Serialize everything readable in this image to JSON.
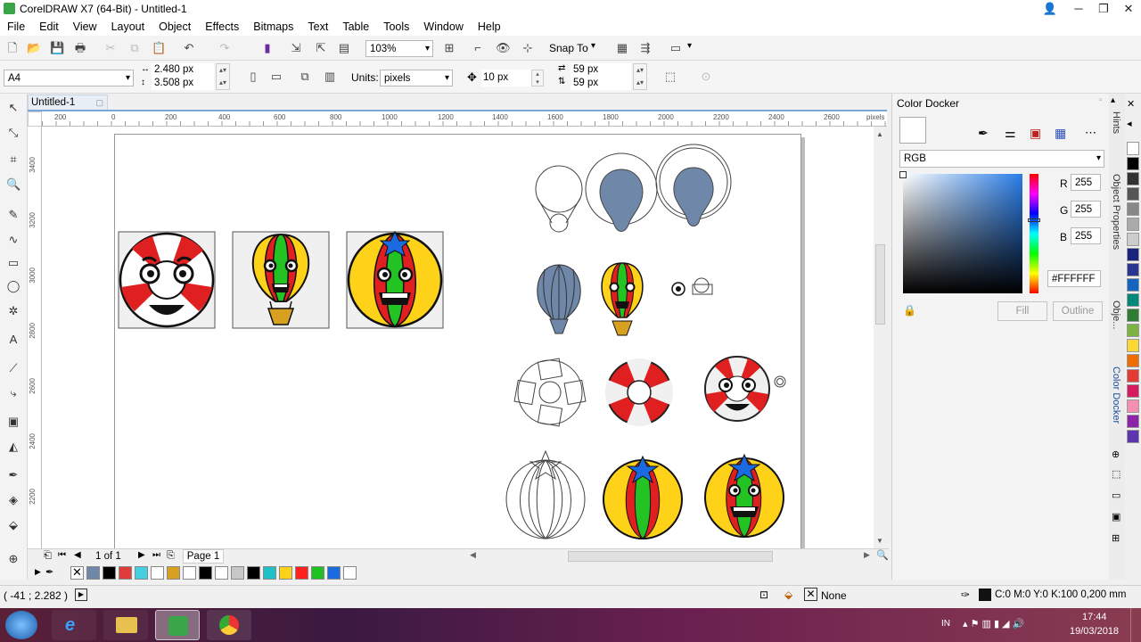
{
  "window": {
    "title": "CorelDRAW X7 (64-Bit) - Untitled-1"
  },
  "menu": [
    "File",
    "Edit",
    "View",
    "Layout",
    "Object",
    "Effects",
    "Bitmaps",
    "Text",
    "Table",
    "Tools",
    "Window",
    "Help"
  ],
  "toolbar": {
    "zoom": "103%",
    "snap_to": "Snap To"
  },
  "property_bar": {
    "page_size": "A4",
    "width": "2.480 px",
    "height": "3.508 px",
    "units_label": "Units:",
    "units": "pixels",
    "nudge": "10 px",
    "dup_x": "59 px",
    "dup_y": "59 px"
  },
  "document": {
    "tab": "Untitled-1"
  },
  "ruler": {
    "h_ticks": [
      "200",
      "0",
      "200",
      "400",
      "600",
      "800",
      "1000",
      "1200",
      "1400",
      "1600",
      "1800",
      "2000",
      "2200",
      "2400",
      "2600"
    ],
    "h_unit": "pixels",
    "v_ticks": [
      "3400",
      "3200",
      "3000",
      "2800",
      "2600",
      "2400",
      "2200"
    ]
  },
  "page_nav": {
    "count": "1 of 1",
    "page_tab": "Page 1"
  },
  "palette": {
    "colors": [
      "#6f87a8",
      "#000000",
      "#e03c3c",
      "#44d0e0",
      "#ffffff",
      "#d8a020",
      "#ffffff",
      "#000000",
      "#ffffff",
      "#c8c8c8",
      "#000000",
      "#20c0c8",
      "#ffd21a",
      "#ff2020",
      "#20c020",
      "#1a6ae0",
      "#ffffff"
    ]
  },
  "right_palette": {
    "colors": [
      "#ffffff",
      "#000000",
      "#333333",
      "#555555",
      "#888888",
      "#aaaaaa",
      "#cccccc",
      "#1a237e",
      "#283593",
      "#1565c0",
      "#00897b",
      "#2e7d32",
      "#7cb342",
      "#fdd835",
      "#ef6c00",
      "#e53935",
      "#d81b60",
      "#f48fb1",
      "#8e24aa",
      "#5e35b1"
    ]
  },
  "color_docker": {
    "title": "Color Docker",
    "model": "RGB",
    "r_label": "R",
    "r": "255",
    "g_label": "G",
    "g": "255",
    "b_label": "B",
    "b": "255",
    "hex": "#FFFFFF",
    "fill_label": "Fill",
    "outline_label": "Outline"
  },
  "side_tabs": [
    "Hints",
    "Object Properties",
    "Obje...",
    "Color Docker"
  ],
  "status": {
    "coords": "( -41 ; 2.282 )",
    "fill_none": "None",
    "outline": "C:0 M:0 Y:0 K:100  0,200 mm"
  },
  "taskbar": {
    "lang": "IN",
    "time": "17:44",
    "date": "19/03/2018"
  }
}
